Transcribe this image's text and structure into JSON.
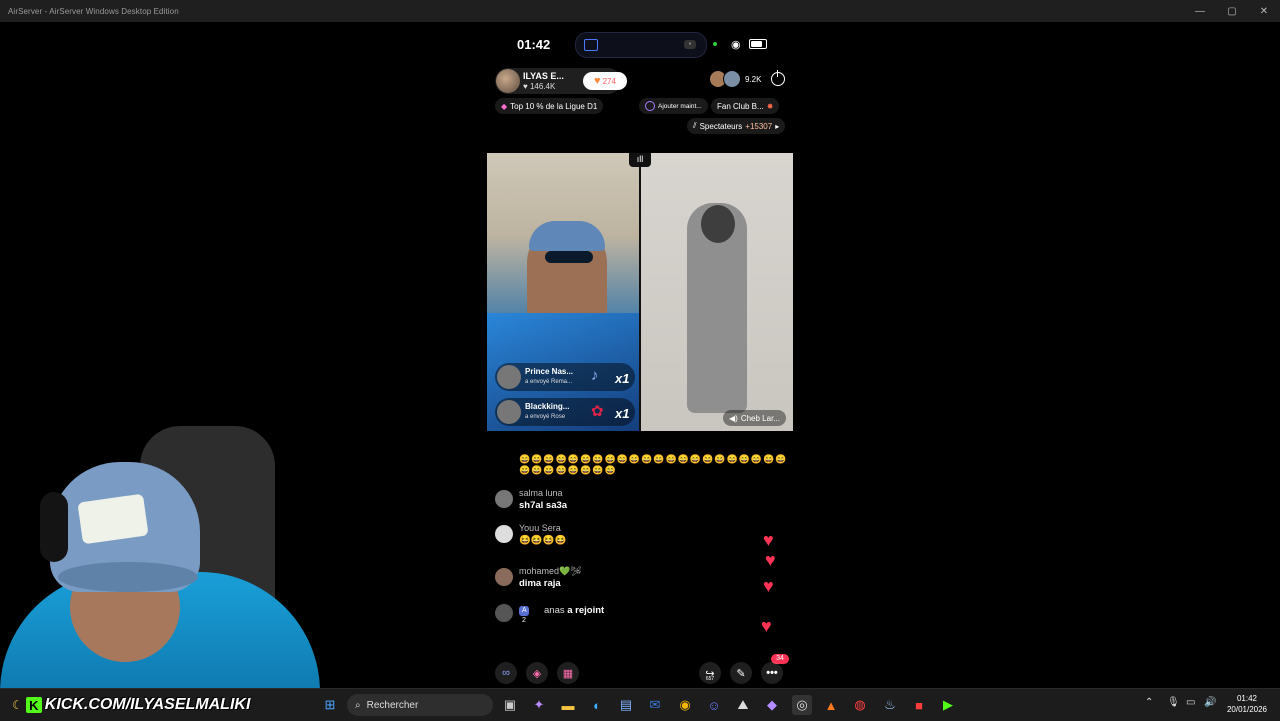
{
  "window": {
    "title": "AirServer - AirServer Windows Desktop Edition",
    "controls": [
      "—",
      "▢",
      "✕"
    ]
  },
  "phone": {
    "status": {
      "time": "01:42"
    },
    "host": {
      "name": "ILYAS E...",
      "likes": "146.4K",
      "follow_count": "274"
    },
    "viewers": {
      "count": "9.2K"
    },
    "pills": {
      "rank": "Top 10 % de la Ligue D1",
      "add": "Ajouter maint...",
      "fanclub": "Fan Club B...",
      "spectators_label": "Spectateurs",
      "spectators_count": "+15307"
    },
    "gifts": [
      {
        "name": "Prince Nas...",
        "sub": "a envoyé  Rema...",
        "mult": "x1",
        "icon": "♪"
      },
      {
        "name": "Blackking...",
        "sub": "a envoyé  Rose",
        "mult": "x1",
        "icon": "✿"
      }
    ],
    "speaker": {
      "name": "Cheb Lar..."
    },
    "emoji_row": "😄😄😄😄😄😄😄😄😄😄😄😄😄😄😄😄😄😄😄😄😄😄😄😄😄😄😄😄😄😄",
    "chat": [
      {
        "user": "salma luna",
        "text": "sh7al sa3a"
      },
      {
        "user": "Youu Sera",
        "text": "😆😆😆😆"
      },
      {
        "user": "mohamed💚🛩",
        "text": "dima raja"
      }
    ],
    "join": {
      "level": "A 2",
      "user": "anas",
      "suffix": "a rejoint"
    },
    "hearts": {
      "count": "34"
    },
    "toolbar": {
      "share_count": "657"
    }
  },
  "overlay": {
    "kick_text": "KICK.COM/ILYASELMALIKI"
  },
  "taskbar": {
    "search_placeholder": "Rechercher",
    "time": "01:42",
    "date": "20/01/2026"
  },
  "colors": {
    "accent": "#53fc18",
    "heart": "#ff3355",
    "spectators": "#ffbfa0"
  }
}
